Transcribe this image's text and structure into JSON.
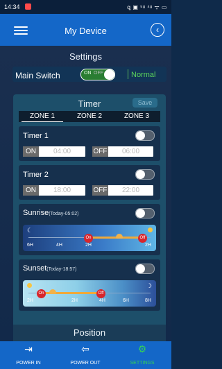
{
  "status_bar": {
    "time": "14:34",
    "right_indicators": "ꝗ ▣ ⁵ᵍ ⁴ᵍ ᯤ ▭"
  },
  "header": {
    "title": "My Device",
    "menu_icon": "hamburger-icon",
    "back_icon": "back-circle-icon"
  },
  "settings": {
    "title": "Settings",
    "main_switch": {
      "label": "Main Switch",
      "toggle_on": "ON",
      "toggle_off": "OFF",
      "status": "Normal"
    }
  },
  "timer": {
    "title": "Timer",
    "save_label": "Save",
    "zones": [
      "ZONE 1",
      "ZONE 2",
      "ZONE 3"
    ],
    "timer1": {
      "label": "Timer 1",
      "on_tag": "ON",
      "on_value": "04:00",
      "off_tag": "OFF",
      "off_value": "06:00"
    },
    "timer2": {
      "label": "Timer 2",
      "on_tag": "ON",
      "on_value": "18:00",
      "off_tag": "OFF",
      "off_value": "22:00"
    },
    "sunrise": {
      "label": "Sunrise",
      "note": "(Today-05:02)",
      "ticks": [
        "6H",
        "4H",
        "2H",
        "2H"
      ],
      "on_pin": "On",
      "off_pin": "Off"
    },
    "sunset": {
      "label": "Sunset",
      "note": "(Today-18:57)",
      "ticks": [
        "2H",
        "2H",
        "4H",
        "6H",
        "8H"
      ],
      "on_pin": "On",
      "off_pin": "Off"
    }
  },
  "position": {
    "title": "Position"
  },
  "bottom_nav": {
    "items": [
      {
        "label": "POWER IN",
        "icon": "arrow-in-icon"
      },
      {
        "label": "POWER OUT",
        "icon": "arrow-out-icon"
      },
      {
        "label": "SETTINGS",
        "icon": "gear-icon"
      }
    ]
  },
  "colors": {
    "accent": "#1467c8",
    "status_ok": "#5bd35b",
    "pin_red": "#d7262c"
  }
}
